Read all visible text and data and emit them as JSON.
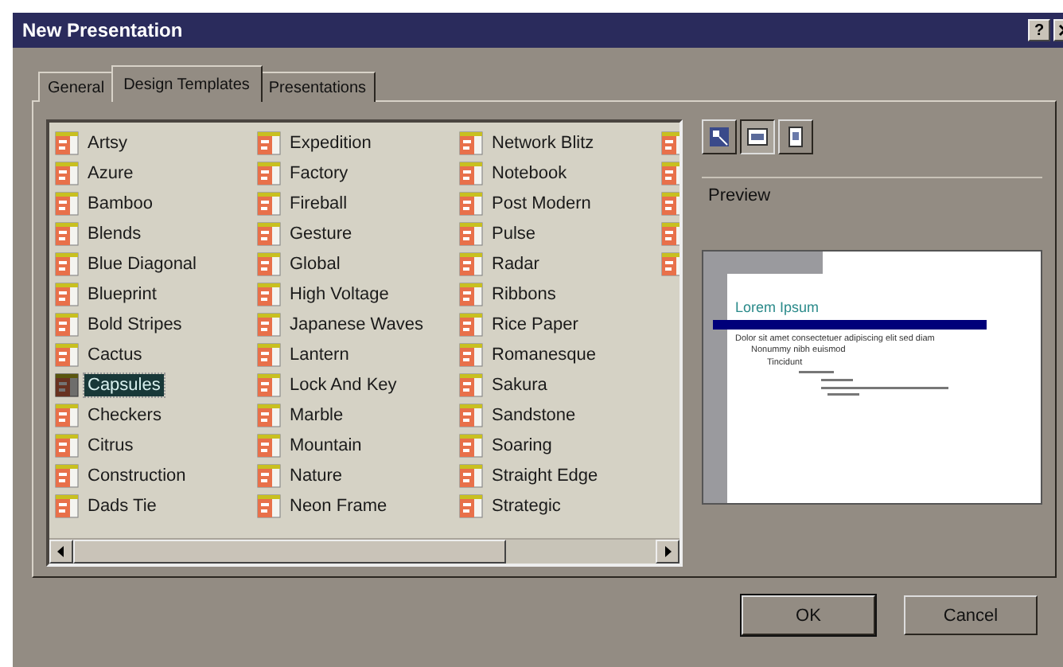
{
  "window": {
    "title": "New Presentation",
    "help_button": "?"
  },
  "tabs": [
    {
      "label": "General",
      "selected": false
    },
    {
      "label": "Design Templates",
      "selected": true
    },
    {
      "label": "Presentations",
      "selected": false
    }
  ],
  "template_columns": [
    [
      {
        "label": "Artsy",
        "selected": false
      },
      {
        "label": "Azure",
        "selected": false
      },
      {
        "label": "Bamboo",
        "selected": false
      },
      {
        "label": "Blends",
        "selected": false
      },
      {
        "label": "Blue Diagonal",
        "selected": false
      },
      {
        "label": "Blueprint",
        "selected": false
      },
      {
        "label": "Bold Stripes",
        "selected": false
      },
      {
        "label": "Cactus",
        "selected": false
      },
      {
        "label": "Capsules",
        "selected": true
      },
      {
        "label": "Checkers",
        "selected": false
      },
      {
        "label": "Citrus",
        "selected": false
      },
      {
        "label": "Construction",
        "selected": false
      },
      {
        "label": "Dads Tie",
        "selected": false
      }
    ],
    [
      {
        "label": "Expedition",
        "selected": false
      },
      {
        "label": "Factory",
        "selected": false
      },
      {
        "label": "Fireball",
        "selected": false
      },
      {
        "label": "Gesture",
        "selected": false
      },
      {
        "label": "Global",
        "selected": false
      },
      {
        "label": "High Voltage",
        "selected": false
      },
      {
        "label": "Japanese Waves",
        "selected": false
      },
      {
        "label": "Lantern",
        "selected": false
      },
      {
        "label": "Lock And Key",
        "selected": false
      },
      {
        "label": "Marble",
        "selected": false
      },
      {
        "label": "Mountain",
        "selected": false
      },
      {
        "label": "Nature",
        "selected": false
      },
      {
        "label": "Neon Frame",
        "selected": false
      }
    ],
    [
      {
        "label": "Network Blitz",
        "selected": false
      },
      {
        "label": "Notebook",
        "selected": false
      },
      {
        "label": "Post Modern",
        "selected": false
      },
      {
        "label": "Pulse",
        "selected": false
      },
      {
        "label": "Radar",
        "selected": false
      },
      {
        "label": "Ribbons",
        "selected": false
      },
      {
        "label": "Rice Paper",
        "selected": false
      },
      {
        "label": "Romanesque",
        "selected": false
      },
      {
        "label": "Sakura",
        "selected": false
      },
      {
        "label": "Sandstone",
        "selected": false
      },
      {
        "label": "Soaring",
        "selected": false
      },
      {
        "label": "Straight Edge",
        "selected": false
      },
      {
        "label": "Strategic",
        "selected": false
      }
    ],
    [
      {
        "selected": false
      },
      {
        "selected": false
      },
      {
        "selected": false
      },
      {
        "selected": false
      },
      {
        "selected": false
      }
    ]
  ],
  "view_buttons": [
    {
      "kind": "large-icons",
      "selected": false
    },
    {
      "kind": "list",
      "selected": true
    },
    {
      "kind": "details",
      "selected": false
    }
  ],
  "preview": {
    "label": "Preview",
    "slide": {
      "title": "Lorem Ipsum",
      "bullets": [
        {
          "text": "Dolor sit amet consectetuer adipiscing elit sed diam",
          "children": [
            {
              "text": "Nonummy nibh euismod",
              "children": [
                {
                  "text": "Tincidunt"
                }
              ]
            }
          ]
        }
      ]
    }
  },
  "buttons": [
    {
      "label": "OK",
      "kind": "default"
    },
    {
      "label": "Cancel",
      "kind": "normal"
    }
  ]
}
